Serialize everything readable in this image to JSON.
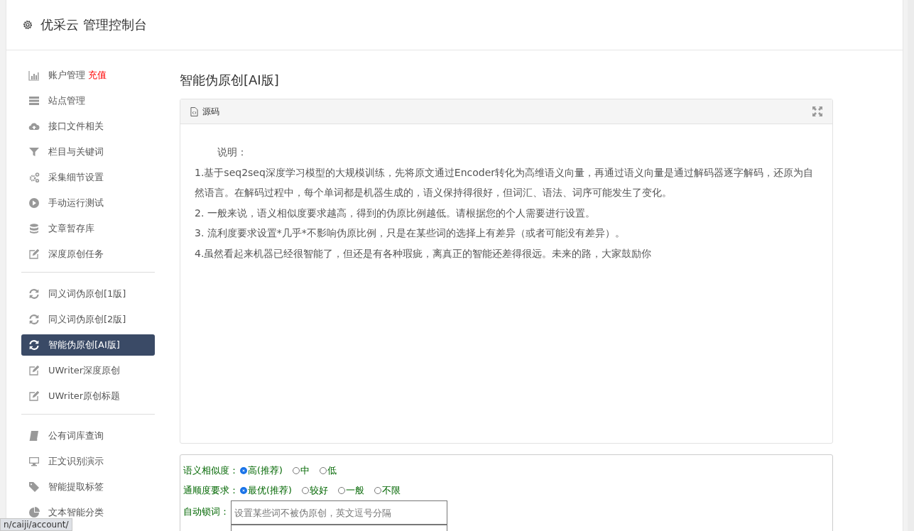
{
  "header": {
    "title": "优采云 管理控制台"
  },
  "sidebar": {
    "groups": [
      [
        {
          "label": "账户管理",
          "badge": "充值",
          "selected": false
        },
        {
          "label": "站点管理",
          "selected": false
        },
        {
          "label": "接口文件相关",
          "selected": false
        },
        {
          "label": "栏目与关键词",
          "selected": false
        },
        {
          "label": "采集细节设置",
          "selected": false
        },
        {
          "label": "手动运行测试",
          "selected": false
        },
        {
          "label": "文章暂存库",
          "selected": false
        },
        {
          "label": "深度原创任务",
          "selected": false
        }
      ],
      [
        {
          "label": "同义词伪原创[1版]",
          "selected": false
        },
        {
          "label": "同义词伪原创[2版]",
          "selected": false
        },
        {
          "label": "智能伪原创[AI版]",
          "selected": true
        },
        {
          "label": "UWriter深度原创",
          "selected": false
        },
        {
          "label": "UWriter原创标题",
          "selected": false
        }
      ],
      [
        {
          "label": "公有词库查询",
          "selected": false
        },
        {
          "label": "正文识别演示",
          "selected": false
        },
        {
          "label": "智能提取标签",
          "selected": false
        },
        {
          "label": "文本智能分类",
          "selected": false
        }
      ]
    ]
  },
  "page_title": "智能伪原创[AI版]",
  "editor": {
    "toolbar_label": "源码",
    "lines": [
      "说明：",
      "1.基于seq2seq深度学习模型的大规模训练，先将原文通过Encoder转化为高维语义向量，再通过语义向量是通过解码器逐字解码，还原为自然语言。在解码过程中，每个单词都是机器生成的，语义保持得很好，但词汇、语法、词序可能发生了变化。",
      "2. 一般来说，语义相似度要求越高，得到的伪原比例越低。请根据您的个人需要进行设置。",
      "3. 流利度要求设置*几乎*不影响伪原比例，只是在某些词的选择上有差异（或者可能没有差异）。",
      "4.虽然看起来机器已经很智能了，但还是有各种瑕疵，离真正的智能还差得很远。未来的路，大家鼓励你"
    ]
  },
  "form": {
    "similarity": {
      "label": "语义相似度：",
      "options": [
        {
          "label": "高(推荐)",
          "selected": true
        },
        {
          "label": "中",
          "selected": false
        },
        {
          "label": "低",
          "selected": false
        }
      ]
    },
    "fluency": {
      "label": "通顺度要求：",
      "options": [
        {
          "label": "最优(推荐)",
          "selected": true
        },
        {
          "label": "较好",
          "selected": false
        },
        {
          "label": "一般",
          "selected": false
        },
        {
          "label": "不限",
          "selected": false
        }
      ]
    },
    "lock_words": {
      "label": "自动锁词：",
      "placeholder": "设置某些词不被伪原创，英文逗号分隔"
    }
  },
  "status_url": "n/caiji/account/"
}
